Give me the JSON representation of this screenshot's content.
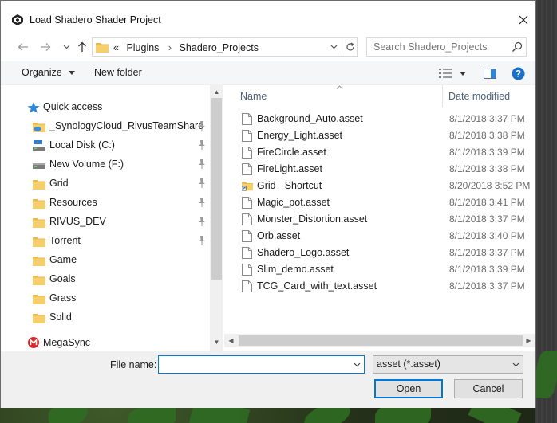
{
  "window": {
    "title": "Load Shadero Shader Project"
  },
  "address_bar": {
    "overflow": "«",
    "crumbs": [
      "Plugins",
      "Shadero_Projects"
    ]
  },
  "search": {
    "placeholder": "Search Shadero_Projects"
  },
  "toolbar": {
    "organize": "Organize",
    "new_folder": "New folder"
  },
  "nav_pane": {
    "items": [
      {
        "label": "Quick access",
        "icon": "star-icon"
      },
      {
        "label": "_SynologyCloud_RivusTeamShare",
        "icon": "cloud-folder-icon",
        "pinned": true
      },
      {
        "label": "Local Disk (C:)",
        "icon": "drive-icon",
        "pinned": true
      },
      {
        "label": "New Volume (F:)",
        "icon": "drive-icon",
        "pinned": true
      },
      {
        "label": "Grid",
        "icon": "folder-icon",
        "pinned": true
      },
      {
        "label": "Resources",
        "icon": "folder-icon",
        "pinned": true
      },
      {
        "label": "RIVUS_DEV",
        "icon": "folder-icon",
        "pinned": true
      },
      {
        "label": "Torrent",
        "icon": "folder-icon",
        "pinned": true
      },
      {
        "label": "Game",
        "icon": "folder-icon"
      },
      {
        "label": "Goals",
        "icon": "folder-icon"
      },
      {
        "label": "Grass",
        "icon": "folder-icon"
      },
      {
        "label": "Solid",
        "icon": "folder-icon"
      },
      {
        "label": "MegaSync",
        "icon": "mega-icon"
      }
    ]
  },
  "file_list": {
    "columns": {
      "name": "Name",
      "date": "Date modified"
    },
    "rows": [
      {
        "name": "Background_Auto.asset",
        "date": "8/1/2018 3:37 PM",
        "icon": "file-icon"
      },
      {
        "name": "Energy_Light.asset",
        "date": "8/1/2018 3:38 PM",
        "icon": "file-icon"
      },
      {
        "name": "FireCircle.asset",
        "date": "8/1/2018 3:39 PM",
        "icon": "file-icon"
      },
      {
        "name": "FireLight.asset",
        "date": "8/1/2018 3:38 PM",
        "icon": "file-icon"
      },
      {
        "name": "Grid - Shortcut",
        "date": "8/20/2018 3:52 PM",
        "icon": "shortcut-folder-icon"
      },
      {
        "name": "Magic_pot.asset",
        "date": "8/1/2018 3:41 PM",
        "icon": "file-icon"
      },
      {
        "name": "Monster_Distortion.asset",
        "date": "8/1/2018 3:37 PM",
        "icon": "file-icon"
      },
      {
        "name": "Orb.asset",
        "date": "8/1/2018 3:40 PM",
        "icon": "file-icon"
      },
      {
        "name": "Shadero_Logo.asset",
        "date": "8/1/2018 3:37 PM",
        "icon": "file-icon"
      },
      {
        "name": "Slim_demo.asset",
        "date": "8/1/2018 3:39 PM",
        "icon": "file-icon"
      },
      {
        "name": "TCG_Card_with_text.asset",
        "date": "8/1/2018 3:37 PM",
        "icon": "file-icon"
      }
    ]
  },
  "footer": {
    "file_name_label": "File name:",
    "file_name_value": "",
    "file_type": "asset (*.asset)",
    "open": "Open",
    "cancel": "Cancel"
  },
  "colors": {
    "accent": "#0078d7",
    "folder": "#e8b94a",
    "quick_access_star": "#2b88d8",
    "header_text": "#4c607a"
  }
}
